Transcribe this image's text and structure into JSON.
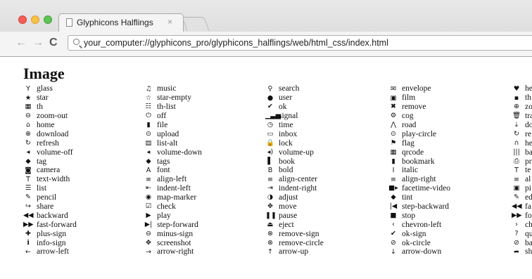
{
  "browser": {
    "tab_title": "Glyphicons Halflings",
    "tab_close": "×",
    "url": "your_computer://glyphicons_pro/glyphicons_halflings/web/html_css/index.html",
    "nav": {
      "back": "←",
      "forward": "→",
      "reload": "C"
    }
  },
  "page": {
    "title": "Image",
    "columns": [
      [
        {
          "icon": "Y",
          "label": "glass",
          "name": "glass"
        },
        {
          "icon": "★",
          "label": "star",
          "name": "star"
        },
        {
          "icon": "▦",
          "label": "th",
          "name": "th"
        },
        {
          "icon": "⊖",
          "label": "zoom-out",
          "name": "zoom-out"
        },
        {
          "icon": "⌂",
          "label": "home",
          "name": "home"
        },
        {
          "icon": "⊕",
          "label": "download",
          "name": "download"
        },
        {
          "icon": "↻",
          "label": "refresh",
          "name": "refresh"
        },
        {
          "icon": "◂",
          "label": "volume-off",
          "name": "volume-off"
        },
        {
          "icon": "◆",
          "label": "tag",
          "name": "tag"
        },
        {
          "icon": "◙",
          "label": "camera",
          "name": "camera"
        },
        {
          "icon": "T",
          "label": "text-width",
          "name": "text-width"
        },
        {
          "icon": "☰",
          "label": "list",
          "name": "list"
        },
        {
          "icon": "✎",
          "label": "pencil",
          "name": "pencil"
        },
        {
          "icon": "↪",
          "label": "share",
          "name": "share"
        },
        {
          "icon": "◀◀",
          "label": "backward",
          "name": "backward"
        },
        {
          "icon": "▶▶",
          "label": "fast-forward",
          "name": "fast-forward"
        },
        {
          "icon": "✚",
          "label": "plus-sign",
          "name": "plus-sign"
        },
        {
          "icon": "ℹ",
          "label": "info-sign",
          "name": "info-sign"
        },
        {
          "icon": "←",
          "label": "arrow-left",
          "name": "arrow-left"
        }
      ],
      [
        {
          "icon": "♫",
          "label": "music",
          "name": "music"
        },
        {
          "icon": "☆",
          "label": "star-empty",
          "name": "star-empty"
        },
        {
          "icon": "☷",
          "label": "th-list",
          "name": "th-list"
        },
        {
          "icon": "⏻",
          "label": "off",
          "name": "off"
        },
        {
          "icon": "▮",
          "label": "file",
          "name": "file"
        },
        {
          "icon": "⊙",
          "label": "upload",
          "name": "upload"
        },
        {
          "icon": "▤",
          "label": "list-alt",
          "name": "list-alt"
        },
        {
          "icon": "◂",
          "label": "volume-down",
          "name": "volume-down"
        },
        {
          "icon": "◆",
          "label": "tags",
          "name": "tags"
        },
        {
          "icon": "A",
          "label": "font",
          "name": "font"
        },
        {
          "icon": "≡",
          "label": "align-left",
          "name": "align-left"
        },
        {
          "icon": "⇤",
          "label": "indent-left",
          "name": "indent-left"
        },
        {
          "icon": "◉",
          "label": "map-marker",
          "name": "map-marker"
        },
        {
          "icon": "☑",
          "label": "check",
          "name": "check"
        },
        {
          "icon": "▶",
          "label": "play",
          "name": "play"
        },
        {
          "icon": "▶|",
          "label": "step-forward",
          "name": "step-forward"
        },
        {
          "icon": "⊖",
          "label": "minus-sign",
          "name": "minus-sign"
        },
        {
          "icon": "✥",
          "label": "screenshot",
          "name": "screenshot"
        },
        {
          "icon": "→",
          "label": "arrow-right",
          "name": "arrow-right"
        }
      ],
      [
        {
          "icon": "⚲",
          "label": "search",
          "name": "search"
        },
        {
          "icon": "●",
          "label": "user",
          "name": "user"
        },
        {
          "icon": "✔",
          "label": "ok",
          "name": "ok"
        },
        {
          "icon": "▁▃▅",
          "label": "signal",
          "name": "signal"
        },
        {
          "icon": "◷",
          "label": "time",
          "name": "time"
        },
        {
          "icon": "▭",
          "label": "inbox",
          "name": "inbox"
        },
        {
          "icon": "🔒",
          "label": "lock",
          "name": "lock"
        },
        {
          "icon": "◂)",
          "label": "volume-up",
          "name": "volume-up"
        },
        {
          "icon": "▌",
          "label": "book",
          "name": "book"
        },
        {
          "icon": "B",
          "label": "bold",
          "name": "bold"
        },
        {
          "icon": "≡",
          "label": "align-center",
          "name": "align-center"
        },
        {
          "icon": "⇥",
          "label": "indent-right",
          "name": "indent-right"
        },
        {
          "icon": "◑",
          "label": "adjust",
          "name": "adjust"
        },
        {
          "icon": "✥",
          "label": "move",
          "name": "move"
        },
        {
          "icon": "❚❚",
          "label": "pause",
          "name": "pause"
        },
        {
          "icon": "⏏",
          "label": "eject",
          "name": "eject"
        },
        {
          "icon": "⊗",
          "label": "remove-sign",
          "name": "remove-sign"
        },
        {
          "icon": "⊗",
          "label": "remove-circle",
          "name": "remove-circle"
        },
        {
          "icon": "↑",
          "label": "arrow-up",
          "name": "arrow-up"
        }
      ],
      [
        {
          "icon": "✉",
          "label": "envelope",
          "name": "envelope"
        },
        {
          "icon": "▣",
          "label": "film",
          "name": "film"
        },
        {
          "icon": "✖",
          "label": "remove",
          "name": "remove"
        },
        {
          "icon": "⚙",
          "label": "cog",
          "name": "cog"
        },
        {
          "icon": "⋀",
          "label": "road",
          "name": "road"
        },
        {
          "icon": "⊙",
          "label": "play-circle",
          "name": "play-circle"
        },
        {
          "icon": "⚑",
          "label": "flag",
          "name": "flag"
        },
        {
          "icon": "▦",
          "label": "qrcode",
          "name": "qrcode"
        },
        {
          "icon": "▮",
          "label": "bookmark",
          "name": "bookmark"
        },
        {
          "icon": "I",
          "label": "italic",
          "name": "italic"
        },
        {
          "icon": "≡",
          "label": "align-right",
          "name": "align-right"
        },
        {
          "icon": "■▸",
          "label": "facetime-video",
          "name": "facetime-video"
        },
        {
          "icon": "◆",
          "label": "tint",
          "name": "tint"
        },
        {
          "icon": "|◀",
          "label": "step-backward",
          "name": "step-backward"
        },
        {
          "icon": "■",
          "label": "stop",
          "name": "stop"
        },
        {
          "icon": "‹",
          "label": "chevron-left",
          "name": "chevron-left"
        },
        {
          "icon": "✔",
          "label": "ok-sign",
          "name": "ok-sign"
        },
        {
          "icon": "⊘",
          "label": "ok-circle",
          "name": "ok-circle"
        },
        {
          "icon": "↓",
          "label": "arrow-down",
          "name": "arrow-down"
        }
      ],
      [
        {
          "icon": "♥",
          "label": "he",
          "name": "heart"
        },
        {
          "icon": "▪",
          "label": "th",
          "name": "th-large"
        },
        {
          "icon": "⊕",
          "label": "zo",
          "name": "zoom-in"
        },
        {
          "icon": "🗑",
          "label": "tra",
          "name": "trash"
        },
        {
          "icon": "⤓",
          "label": "do",
          "name": "download-alt"
        },
        {
          "icon": "↻",
          "label": "re",
          "name": "repeat"
        },
        {
          "icon": "∩",
          "label": "he",
          "name": "headphones"
        },
        {
          "icon": "|||",
          "label": "ba",
          "name": "barcode"
        },
        {
          "icon": "⎙",
          "label": "pr",
          "name": "print"
        },
        {
          "icon": "T",
          "label": "te",
          "name": "text-height"
        },
        {
          "icon": "≡",
          "label": "al",
          "name": "align-justify"
        },
        {
          "icon": "▣",
          "label": "pi",
          "name": "picture"
        },
        {
          "icon": "✎",
          "label": "ed",
          "name": "edit"
        },
        {
          "icon": "◀◀",
          "label": "fa",
          "name": "fast-backward"
        },
        {
          "icon": "▶▶",
          "label": "fo",
          "name": "forward"
        },
        {
          "icon": "›",
          "label": "ch",
          "name": "chevron-right"
        },
        {
          "icon": "?",
          "label": "qu",
          "name": "question-sign"
        },
        {
          "icon": "⊘",
          "label": "ba",
          "name": "ban-circle"
        },
        {
          "icon": "➦",
          "label": "sh",
          "name": "share-alt"
        }
      ]
    ]
  }
}
